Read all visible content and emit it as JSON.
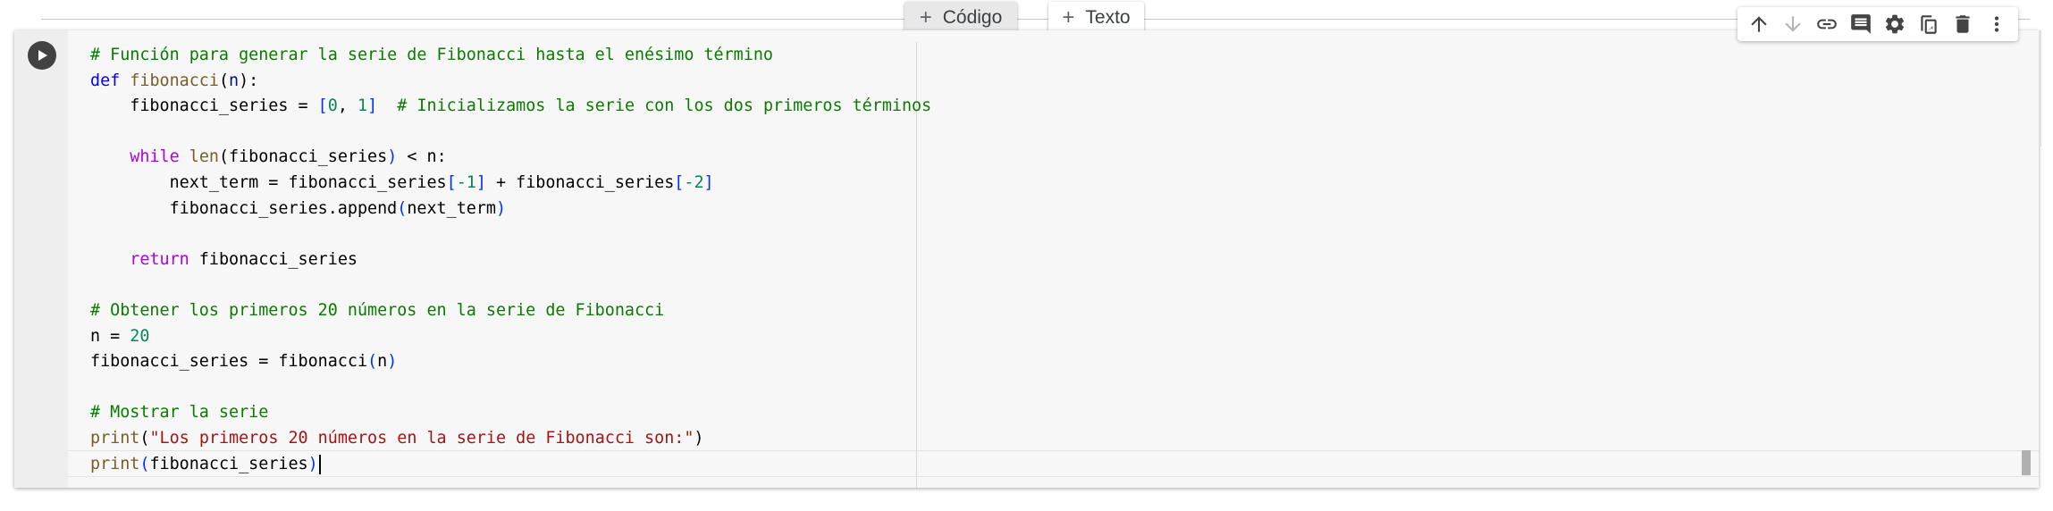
{
  "add_buttons": {
    "code_label": "Código",
    "text_label": "Texto"
  },
  "toolbar": {
    "icons": [
      "arrow-up-icon",
      "arrow-down-icon",
      "link-icon",
      "comment-icon",
      "gear-icon",
      "mirror-cell-icon",
      "delete-icon",
      "more-vert-icon"
    ]
  },
  "cell": {
    "code_lines": [
      [
        {
          "t": "# Función para generar la serie de Fibonacci hasta el enésimo término",
          "c": "comment"
        }
      ],
      [
        {
          "t": "def",
          "c": "kw"
        },
        {
          "t": " "
        },
        {
          "t": "fibonacci",
          "c": "fn"
        },
        {
          "t": "("
        },
        {
          "t": "n",
          "c": "param"
        },
        {
          "t": "):"
        }
      ],
      [
        {
          "t": "    fibonacci_series = "
        },
        {
          "t": "[",
          "c": "br"
        },
        {
          "t": "0",
          "c": "num"
        },
        {
          "t": ", "
        },
        {
          "t": "1",
          "c": "num"
        },
        {
          "t": "]",
          "c": "br"
        },
        {
          "t": "  "
        },
        {
          "t": "# Inicializamos la serie con los dos primeros términos",
          "c": "comment"
        }
      ],
      [
        {
          "t": ""
        }
      ],
      [
        {
          "t": "    "
        },
        {
          "t": "while",
          "c": "flow"
        },
        {
          "t": " "
        },
        {
          "t": "len",
          "c": "fn"
        },
        {
          "t": "(fibonacci_series"
        },
        {
          "t": ")",
          "c": "br"
        },
        {
          "t": " < n:"
        }
      ],
      [
        {
          "t": "        next_term = fibonacci_series"
        },
        {
          "t": "[",
          "c": "br"
        },
        {
          "t": "-1",
          "c": "num"
        },
        {
          "t": "]",
          "c": "br"
        },
        {
          "t": " + fibonacci_series"
        },
        {
          "t": "[",
          "c": "br"
        },
        {
          "t": "-2",
          "c": "num"
        },
        {
          "t": "]",
          "c": "br"
        }
      ],
      [
        {
          "t": "        fibonacci_series.append"
        },
        {
          "t": "(",
          "c": "br"
        },
        {
          "t": "next_term"
        },
        {
          "t": ")",
          "c": "br"
        }
      ],
      [
        {
          "t": ""
        }
      ],
      [
        {
          "t": "    "
        },
        {
          "t": "return",
          "c": "flow"
        },
        {
          "t": " fibonacci_series"
        }
      ],
      [
        {
          "t": ""
        }
      ],
      [
        {
          "t": "# Obtener los primeros 20 números en la serie de Fibonacci",
          "c": "comment"
        }
      ],
      [
        {
          "t": "n = "
        },
        {
          "t": "20",
          "c": "num"
        }
      ],
      [
        {
          "t": "fibonacci_series = fibonacci"
        },
        {
          "t": "(",
          "c": "br"
        },
        {
          "t": "n"
        },
        {
          "t": ")",
          "c": "br"
        }
      ],
      [
        {
          "t": ""
        }
      ],
      [
        {
          "t": "# Mostrar la serie",
          "c": "comment"
        }
      ],
      [
        {
          "t": "print",
          "c": "fn"
        },
        {
          "t": "("
        },
        {
          "t": "\"Los primeros 20 números en la serie de Fibonacci son:\"",
          "c": "str"
        },
        {
          "t": ")"
        }
      ],
      [
        {
          "t": "print",
          "c": "fn"
        },
        {
          "t": "(",
          "c": "br"
        },
        {
          "t": "fibonacci_series"
        },
        {
          "t": ")",
          "c": "br"
        }
      ]
    ]
  }
}
